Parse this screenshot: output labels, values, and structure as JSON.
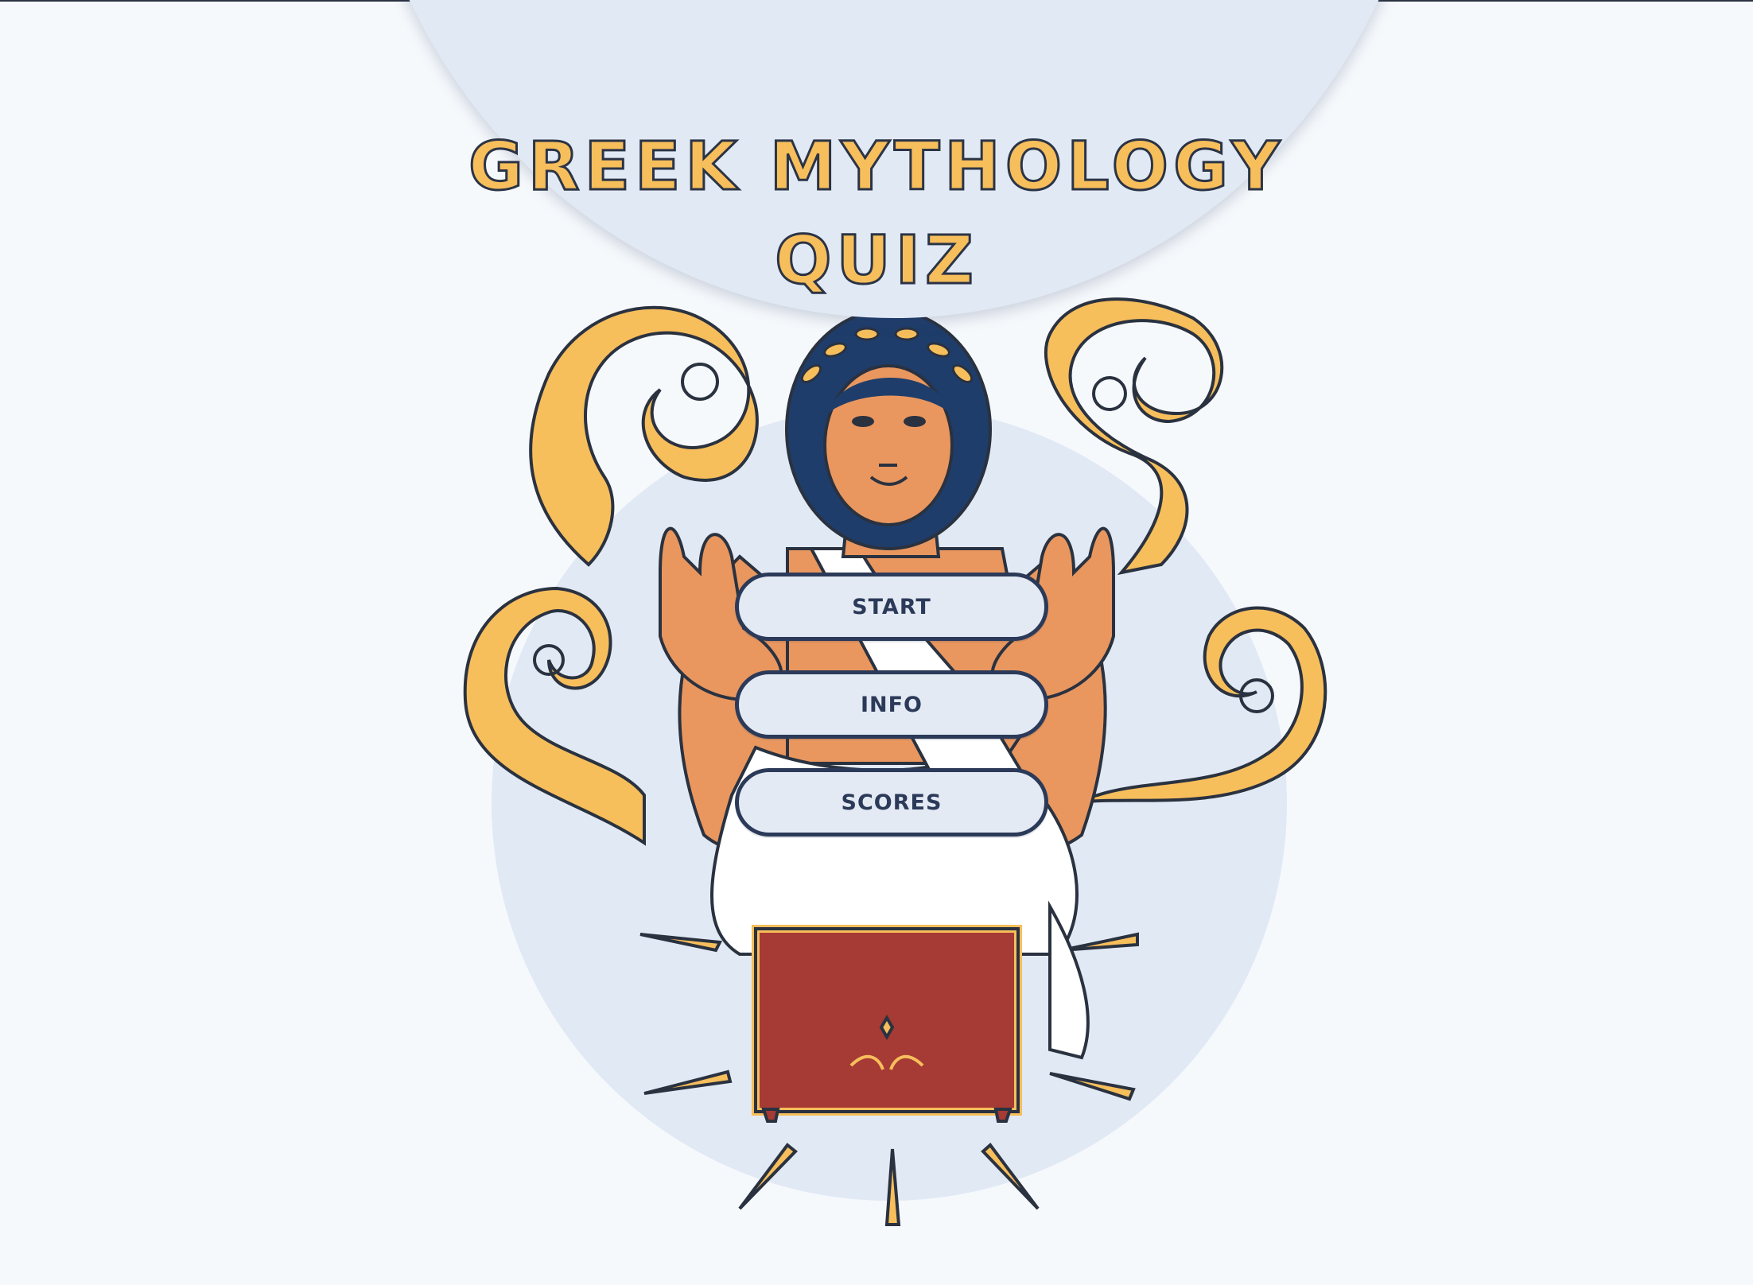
{
  "title": {
    "line1": "GREEK MYTHOLOGY",
    "line2": "QUIZ"
  },
  "menu": {
    "buttons": [
      "START",
      "INFO",
      "SCORES"
    ]
  },
  "colors": {
    "background": "#f6f9fc",
    "dome": "#e1e9f5",
    "title_fill": "#f7be5c",
    "title_stroke": "#2b3446",
    "button_border": "#2c3a59",
    "button_fill": "#e4eaf4",
    "chest_red": "#a63a34"
  },
  "illustration": "goddess-with-laurel-wreath-holding-quiz-buttons"
}
